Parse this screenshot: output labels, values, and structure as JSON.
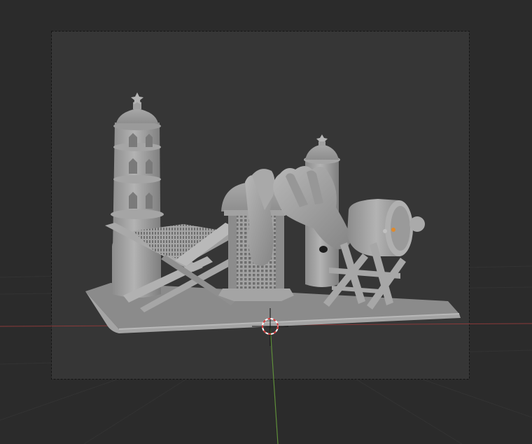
{
  "viewport": {
    "mode": "camera-view",
    "shading": "solid",
    "background_color": "#2b2b2b",
    "camera_frame_color": "#363636"
  },
  "axes": {
    "x_axis_color": "#8a3a3a",
    "y_axis_color": "#5f8f3a"
  },
  "scene": {
    "objects": [
      "base-platform",
      "left-minaret",
      "quran-stand",
      "lantern",
      "praying-hands",
      "right-minaret",
      "bedug-drum",
      "drum-stand"
    ],
    "material_color": "#9a9a9a",
    "selected_origin_color": "#e08a2c"
  },
  "cursor": {
    "icon": "3d-cursor-icon",
    "colors": [
      "#d23a3a",
      "#ffffff"
    ]
  }
}
